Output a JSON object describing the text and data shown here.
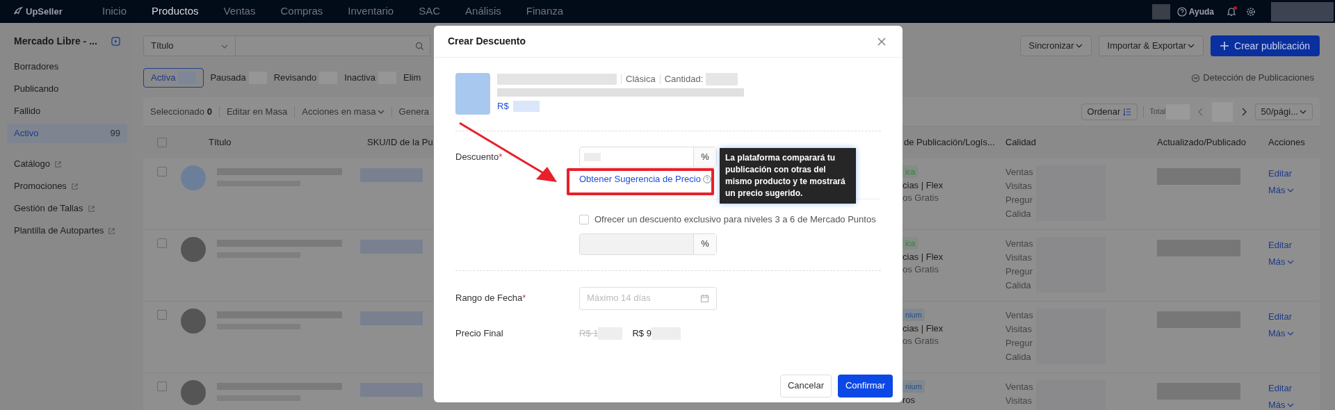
{
  "top_nav": {
    "logo": "UpSeller",
    "items": [
      {
        "label": "Inicio",
        "selected": false
      },
      {
        "label": "Productos",
        "selected": true
      },
      {
        "label": "Ventas",
        "selected": false
      },
      {
        "label": "Compras",
        "selected": false
      },
      {
        "label": "Inventario",
        "selected": false
      },
      {
        "label": "SAC",
        "selected": false
      },
      {
        "label": "Análisis",
        "selected": false
      },
      {
        "label": "Finanza",
        "selected": false
      }
    ],
    "help": "Ayuda",
    "notification": true
  },
  "sidebar": {
    "store": "Mercado Libre - ...",
    "items": [
      {
        "label": "Borradores",
        "selected": false
      },
      {
        "label": "Publicando",
        "selected": false
      },
      {
        "label": "Fallido",
        "selected": false
      },
      {
        "label": "Activo",
        "count": "99",
        "selected": true
      }
    ],
    "links": [
      "Catálogo",
      "Promociones",
      "Gestión de Tallas",
      "Plantilla de Autopartes"
    ]
  },
  "toolbar": {
    "search_type": "Título",
    "buttons": [
      {
        "label": "Sincronizar",
        "kind": "dropdown"
      },
      {
        "label": "Importar & Exportar",
        "kind": "dropdown"
      },
      {
        "label": "Crear publicación",
        "kind": "primary"
      }
    ]
  },
  "status_tabs": [
    {
      "label": "Activa",
      "selected": true
    },
    {
      "label": "Pausada",
      "selected": false
    },
    {
      "label": "Revisando",
      "selected": false
    },
    {
      "label": "Inactiva",
      "selected": false
    },
    {
      "label": "Elim",
      "selected": false
    }
  ],
  "detection_link": "Detección de Publicaciones",
  "table": {
    "selected_label": "Seleccionado",
    "selected_count": "0",
    "bulk_actions": [
      {
        "label": "Editar en Masa",
        "kind": "plain"
      },
      {
        "label": "Acciones en masa",
        "kind": "dropdown"
      },
      {
        "label": "Genera",
        "kind": "plain"
      }
    ],
    "select_all_checked": false,
    "sort_label": "Ordenar",
    "total_label": "Total",
    "page_size": "50/pági...",
    "columns_left": [
      "Título",
      "SKU/ID de la Pu"
    ],
    "columns_right": [
      "de Publicación/Logís...",
      "Calidad",
      "Actualizado/Publicado",
      "Acciones"
    ],
    "rows": [
      {
        "checked": false,
        "tag": "ica",
        "color": "#2f7d3b",
        "shipping": "cias | Flex",
        "shipping_note": "os Gratis",
        "quality": [
          "Ventas",
          "Visitas",
          "Pregur",
          "Calida"
        ],
        "edit": "Editar",
        "more": "Más"
      },
      {
        "checked": false,
        "tag": "ica",
        "color": "#2f7d3b",
        "shipping": "cias | Flex",
        "shipping_note": "os Gratis",
        "quality": [
          "Ventas",
          "Visitas",
          "Pregur",
          "Calida"
        ],
        "edit": "Editar",
        "more": "Más"
      },
      {
        "checked": false,
        "tag": "nium",
        "color": "#1e4f8a",
        "shipping": "cias | Flex",
        "shipping_note": "os Gratis",
        "quality": [
          "Ventas",
          "Visitas",
          "Pregur",
          "Calida"
        ],
        "edit": "Editar",
        "more": "Más"
      },
      {
        "checked": false,
        "tag": "nium",
        "color": "#1e4f8a",
        "shipping": "ros",
        "quality": [
          "Ventas",
          "Visitas"
        ],
        "edit": "Editar",
        "more": "Más"
      }
    ]
  },
  "modal": {
    "title": "Crear Descuento",
    "product": {
      "listing_type": "Clásica",
      "quantity_label": "Cantidad:",
      "price_prefix": "R$"
    },
    "discount": {
      "label": "Descuento",
      "required_mark": "*",
      "unit": "%",
      "suggestion_link": "Obtener Sugerencia de Precio",
      "tooltip": "La plataforma comparará tu publicación con otras del mismo producto y te mostrará un precio sugerido."
    },
    "points_offer": {
      "label": "Ofrecer un descuento exclusivo para niveles 3 a 6 de Mercado Puntos",
      "checked": false,
      "disabled": true,
      "unit": "%"
    },
    "date_range": {
      "label": "Rango de Fecha",
      "required_mark": "*",
      "placeholder": "Máximo 14 días"
    },
    "final_price": {
      "label": "Precio Final",
      "original": "R$ 1",
      "discounted": "R$ 9"
    },
    "buttons": [
      {
        "label": "Cancelar",
        "kind": "secondary"
      },
      {
        "label": "Confirmar",
        "kind": "primary"
      }
    ]
  }
}
